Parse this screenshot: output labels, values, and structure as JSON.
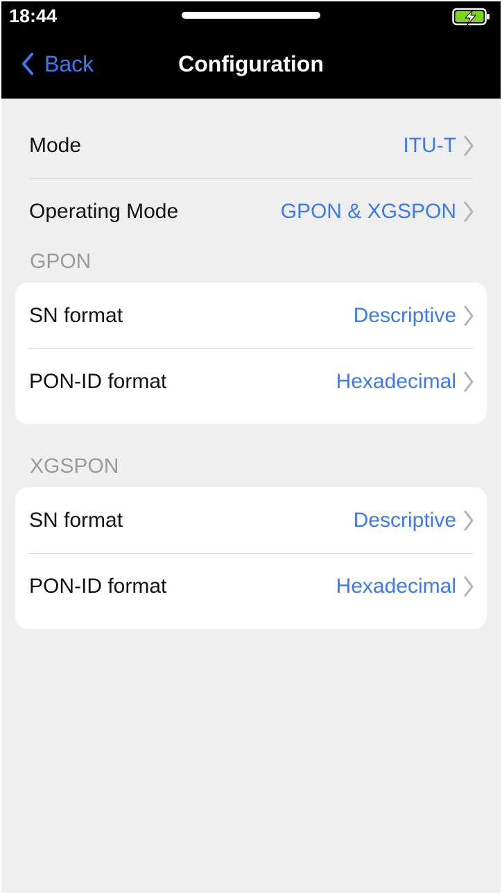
{
  "status": {
    "time": "18:44"
  },
  "nav": {
    "back_label": "Back",
    "title": "Configuration"
  },
  "general": {
    "rows": [
      {
        "label": "Mode",
        "value": "ITU-T"
      },
      {
        "label": "Operating Mode",
        "value": "GPON & XGSPON"
      }
    ]
  },
  "gpon": {
    "title": "GPON",
    "rows": [
      {
        "label": "SN format",
        "value": "Descriptive"
      },
      {
        "label": "PON-ID format",
        "value": "Hexadecimal"
      }
    ]
  },
  "xgspon": {
    "title": "XGSPON",
    "rows": [
      {
        "label": "SN format",
        "value": "Descriptive"
      },
      {
        "label": "PON-ID format",
        "value": "Hexadecimal"
      }
    ]
  },
  "icons": {
    "back": "chevron-left-icon",
    "row_chevron": "chevron-right-icon",
    "battery": "battery-charging-icon"
  },
  "colors": {
    "accent": "#3a7bf2",
    "header_bg": "#000000",
    "page_bg": "#efefef",
    "battery": "#7ed321"
  }
}
